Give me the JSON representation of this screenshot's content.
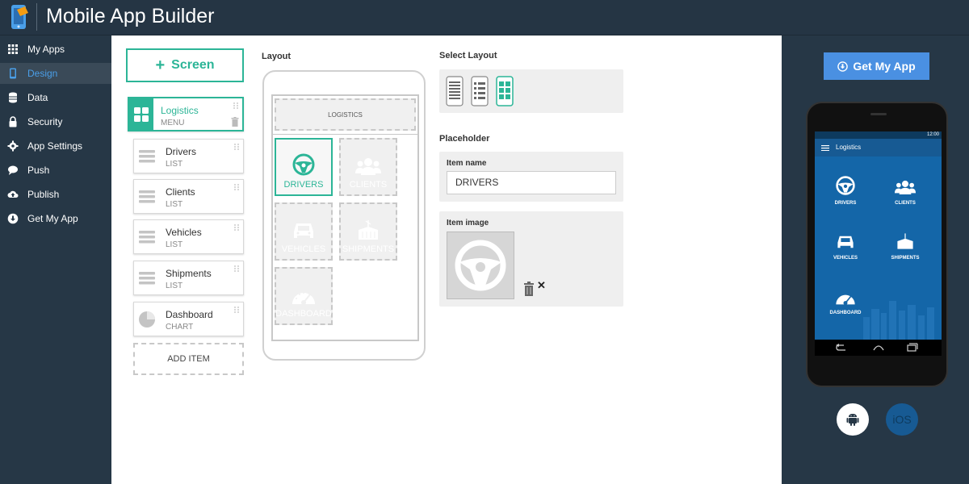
{
  "app": {
    "title": "Mobile App Builder"
  },
  "sidebar": {
    "items": [
      {
        "label": "My Apps",
        "icon": "grid-icon"
      },
      {
        "label": "Design",
        "icon": "phone-icon"
      },
      {
        "label": "Data",
        "icon": "database-icon"
      },
      {
        "label": "Security",
        "icon": "lock-icon"
      },
      {
        "label": "App Settings",
        "icon": "gear-icon"
      },
      {
        "label": "Push",
        "icon": "chat-icon"
      },
      {
        "label": "Publish",
        "icon": "cloud-upload-icon"
      },
      {
        "label": "Get My App",
        "icon": "download-circle-icon"
      }
    ],
    "active": "Design"
  },
  "screens": {
    "add_button_label": "Screen",
    "items": [
      {
        "name": "Logistics",
        "type": "MENU",
        "icon": "menu-grid-icon"
      },
      {
        "name": "Drivers",
        "type": "LIST",
        "icon": "list-icon"
      },
      {
        "name": "Clients",
        "type": "LIST",
        "icon": "list-icon"
      },
      {
        "name": "Vehicles",
        "type": "LIST",
        "icon": "list-icon"
      },
      {
        "name": "Shipments",
        "type": "LIST",
        "icon": "list-icon"
      },
      {
        "name": "Dashboard",
        "type": "CHART",
        "icon": "pie-chart-icon"
      }
    ],
    "add_item_label": "ADD ITEM"
  },
  "layout": {
    "label": "Layout",
    "header_text": "LOGISTICS",
    "tiles": [
      {
        "label": "DRIVERS",
        "icon": "steering-wheel-icon"
      },
      {
        "label": "CLIENTS",
        "icon": "people-icon"
      },
      {
        "label": "VEHICLES",
        "icon": "car-icon"
      },
      {
        "label": "SHIPMENTS",
        "icon": "shipment-icon"
      },
      {
        "label": "DASHBOARD",
        "icon": "gauge-icon"
      }
    ]
  },
  "select_layout": {
    "label": "Select Layout",
    "options": [
      "list-layout-icon",
      "detail-list-layout-icon",
      "grid-layout-icon"
    ],
    "selected": "grid-layout-icon"
  },
  "placeholder": {
    "label": "Placeholder",
    "item_name_label": "Item name",
    "item_name_value": "DRIVERS",
    "item_image_label": "Item image",
    "remove_symbol": "✕"
  },
  "preview": {
    "get_app_label": "Get My App",
    "status_time": "12:00",
    "app_bar_title": "Logistics",
    "tiles": [
      "DRIVERS",
      "CLIENTS",
      "VEHICLES",
      "SHIPMENTS",
      "DASHBOARD"
    ],
    "ios_label": "iOS"
  },
  "colors": {
    "accent": "#2cb597",
    "sidebar_bg": "#263746",
    "active_nav": "#4a9fe8",
    "button_blue": "#4a90e2",
    "device_screen": "#1466a8"
  }
}
